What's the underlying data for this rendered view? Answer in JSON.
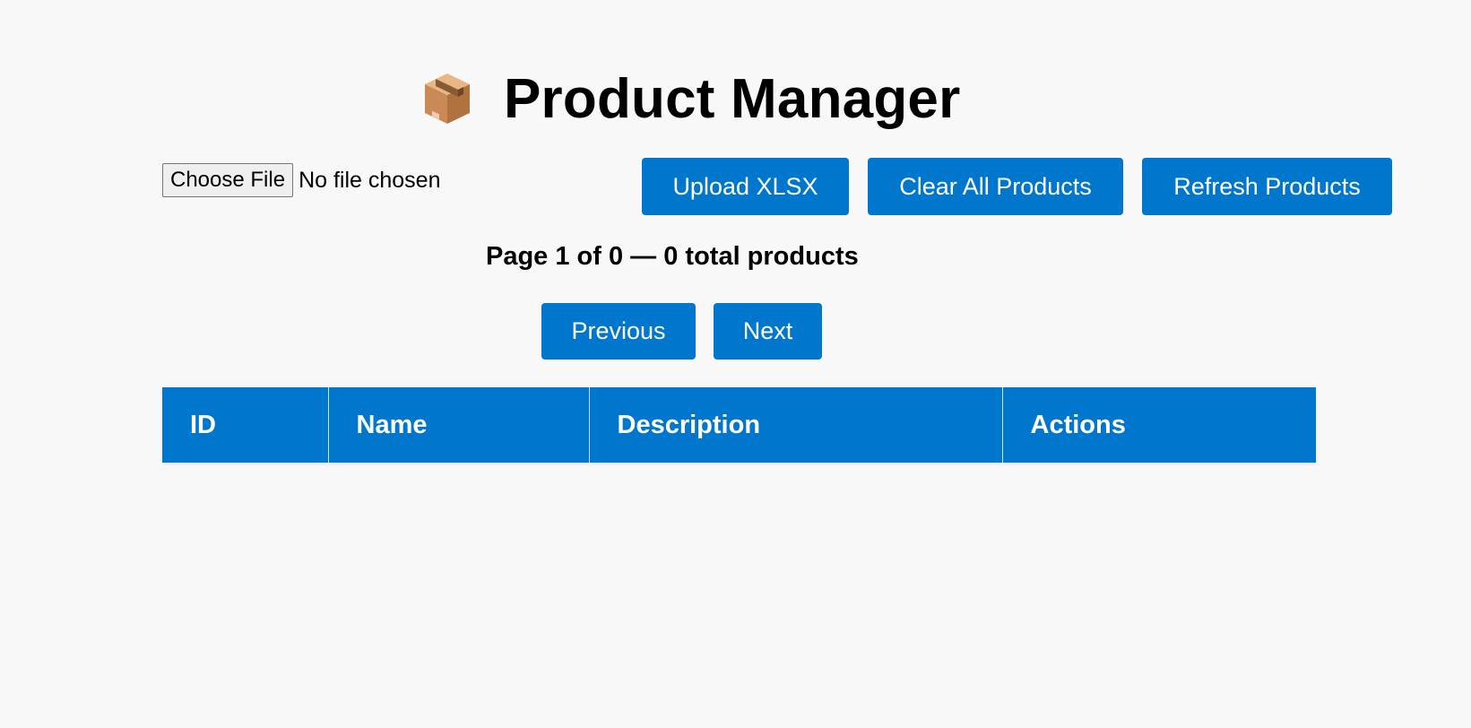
{
  "header": {
    "icon": "package-box-icon",
    "title": "Product Manager"
  },
  "file_input": {
    "button_label": "Choose File",
    "status": "No file chosen"
  },
  "toolbar": {
    "upload_label": "Upload XLSX",
    "clear_label": "Clear All Products",
    "refresh_label": "Refresh Products"
  },
  "pagination": {
    "info": "Page 1 of 0 — 0 total products",
    "current_page": 1,
    "total_pages": 0,
    "total_products": 0,
    "previous_label": "Previous",
    "next_label": "Next"
  },
  "table": {
    "columns": [
      "ID",
      "Name",
      "Description",
      "Actions"
    ],
    "rows": []
  },
  "colors": {
    "accent": "#0077cc",
    "background": "#f8f8f8",
    "header_text": "#ffffff"
  }
}
